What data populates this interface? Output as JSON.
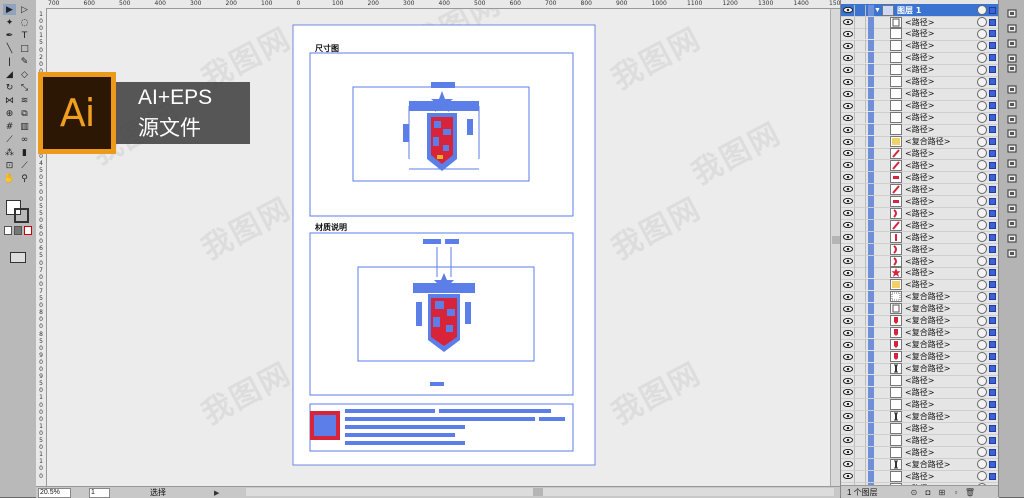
{
  "tools": [
    {
      "icon": "selection-arrow-icon",
      "glyph": "▶",
      "sel": true
    },
    {
      "icon": "direct-selection-icon",
      "glyph": "▷"
    },
    {
      "icon": "magic-wand-icon",
      "glyph": "✦"
    },
    {
      "icon": "lasso-icon",
      "glyph": "◌"
    },
    {
      "icon": "pen-icon",
      "glyph": "✒"
    },
    {
      "icon": "type-icon",
      "glyph": "T"
    },
    {
      "icon": "line-icon",
      "glyph": "╲"
    },
    {
      "icon": "rectangle-icon",
      "glyph": "□"
    },
    {
      "icon": "brush-icon",
      "glyph": "ǀ"
    },
    {
      "icon": "pencil-icon",
      "glyph": "✎"
    },
    {
      "icon": "blob-brush-icon",
      "glyph": "◢"
    },
    {
      "icon": "eraser-icon",
      "glyph": "◇"
    },
    {
      "icon": "rotate-icon",
      "glyph": "↻"
    },
    {
      "icon": "scale-icon",
      "glyph": "⤡"
    },
    {
      "icon": "width-icon",
      "glyph": "⋈"
    },
    {
      "icon": "warp-icon",
      "glyph": "≋"
    },
    {
      "icon": "shape-builder-icon",
      "glyph": "⊕"
    },
    {
      "icon": "perspective-icon",
      "glyph": "⧉"
    },
    {
      "icon": "mesh-icon",
      "glyph": "#"
    },
    {
      "icon": "gradient-icon",
      "glyph": "▥"
    },
    {
      "icon": "eyedropper-icon",
      "glyph": "⟋"
    },
    {
      "icon": "blend-icon",
      "glyph": "∞"
    },
    {
      "icon": "symbol-sprayer-icon",
      "glyph": "⁂"
    },
    {
      "icon": "column-graph-icon",
      "glyph": "▮"
    },
    {
      "icon": "artboard-icon",
      "glyph": "⊡"
    },
    {
      "icon": "slice-icon",
      "glyph": "⟋"
    },
    {
      "icon": "hand-icon",
      "glyph": "✋"
    },
    {
      "icon": "zoom-icon",
      "glyph": "⚲"
    }
  ],
  "hruler_ticks": [
    "700",
    "600",
    "500",
    "400",
    "300",
    "200",
    "100",
    "0",
    "100",
    "200",
    "300",
    "400",
    "500",
    "600",
    "700",
    "800",
    "900",
    "1000",
    "1100",
    "1200",
    "1300",
    "1400",
    "1500"
  ],
  "vruler_ticks": [
    "1",
    "0",
    "0",
    "1",
    "5",
    "0",
    "2",
    "0",
    "0",
    "2",
    "5",
    "0",
    "3",
    "0",
    "0",
    "3",
    "5",
    "0",
    "4",
    "0",
    "0",
    "4",
    "5",
    "0",
    "5",
    "0",
    "0",
    "5",
    "5",
    "0",
    "6",
    "0",
    "0",
    "6",
    "5",
    "0",
    "7",
    "0",
    "0",
    "7",
    "5",
    "0",
    "8",
    "0",
    "0",
    "8",
    "5",
    "0",
    "9",
    "0",
    "0",
    "9",
    "5",
    "0",
    "1",
    "0",
    "0",
    "0",
    "1",
    "0",
    "5",
    "0",
    "1",
    "1",
    "0",
    "0"
  ],
  "artboard": {
    "section1_title": "尺寸图",
    "section2_title": "材质说明"
  },
  "watermark_text": "我图网",
  "badge": {
    "logo": "Ai",
    "line1": "AI+EPS",
    "line2": "源文件"
  },
  "status": {
    "zoom": "20.5%",
    "page": "1",
    "mode": "选择",
    "arrow": "▶"
  },
  "layers": {
    "layer_name": "图层 1",
    "items": [
      {
        "label": "<路径>",
        "thumb": "border"
      },
      {
        "label": "<路径>",
        "thumb": "blank"
      },
      {
        "label": "<路径>",
        "thumb": "blank"
      },
      {
        "label": "<路径>",
        "thumb": "blank"
      },
      {
        "label": "<路径>",
        "thumb": "blank"
      },
      {
        "label": "<路径>",
        "thumb": "blank"
      },
      {
        "label": "<路径>",
        "thumb": "blank"
      },
      {
        "label": "<路径>",
        "thumb": "blank"
      },
      {
        "label": "<路径>",
        "thumb": "blank"
      },
      {
        "label": "<路径>",
        "thumb": "blank"
      },
      {
        "label": "<复合路径>",
        "thumb": "yellow"
      },
      {
        "label": "<路径>",
        "thumb": "redslash"
      },
      {
        "label": "<路径>",
        "thumb": "redslash"
      },
      {
        "label": "<路径>",
        "thumb": "redbar"
      },
      {
        "label": "<路径>",
        "thumb": "redslash"
      },
      {
        "label": "<路径>",
        "thumb": "redbar"
      },
      {
        "label": "<路径>",
        "thumb": "redcurve"
      },
      {
        "label": "<路径>",
        "thumb": "redslash"
      },
      {
        "label": "<路径>",
        "thumb": "redtick"
      },
      {
        "label": "<路径>",
        "thumb": "redcurve"
      },
      {
        "label": "<路径>",
        "thumb": "redcurve"
      },
      {
        "label": "<路径>",
        "thumb": "star"
      },
      {
        "label": "<路径>",
        "thumb": "yellow"
      },
      {
        "label": "<复合路径>",
        "thumb": "dashed"
      },
      {
        "label": "<复合路径>",
        "thumb": "border"
      },
      {
        "label": "<复合路径>",
        "thumb": "redshape"
      },
      {
        "label": "<复合路径>",
        "thumb": "redshape"
      },
      {
        "label": "<复合路径>",
        "thumb": "redshape"
      },
      {
        "label": "<复合路径>",
        "thumb": "redshape"
      },
      {
        "label": "<复合路径>",
        "thumb": "bracket"
      },
      {
        "label": "<路径>",
        "thumb": "blank"
      },
      {
        "label": "<路径>",
        "thumb": "blank"
      },
      {
        "label": "<路径>",
        "thumb": "blank"
      },
      {
        "label": "<复合路径>",
        "thumb": "bracket"
      },
      {
        "label": "<路径>",
        "thumb": "blank"
      },
      {
        "label": "<路径>",
        "thumb": "blank"
      },
      {
        "label": "<路径>",
        "thumb": "blank"
      },
      {
        "label": "<复合路径>",
        "thumb": "bracket"
      },
      {
        "label": "<路径>",
        "thumb": "blank"
      },
      {
        "label": "<路径>",
        "thumb": "blank"
      }
    ],
    "footer_count": "1 个图层"
  },
  "dock_icons": [
    "brush-panel-icon",
    "symbols-panel-icon",
    "graphic-styles-icon",
    "swatches-icon",
    "stroke-icon",
    "gradient-panel-icon",
    "transparency-icon",
    "appearance-icon",
    "align-icon",
    "pathfinder-icon",
    "transform-icon",
    "info-icon",
    "navigator-icon",
    "color-guide-icon",
    "artboards-panel-icon",
    "links-icon",
    "actions-icon"
  ],
  "colors": {
    "accent": "#3a74d0",
    "path": "#5b7ee8",
    "red": "#d8243a",
    "orange": "#ec9a1c"
  }
}
